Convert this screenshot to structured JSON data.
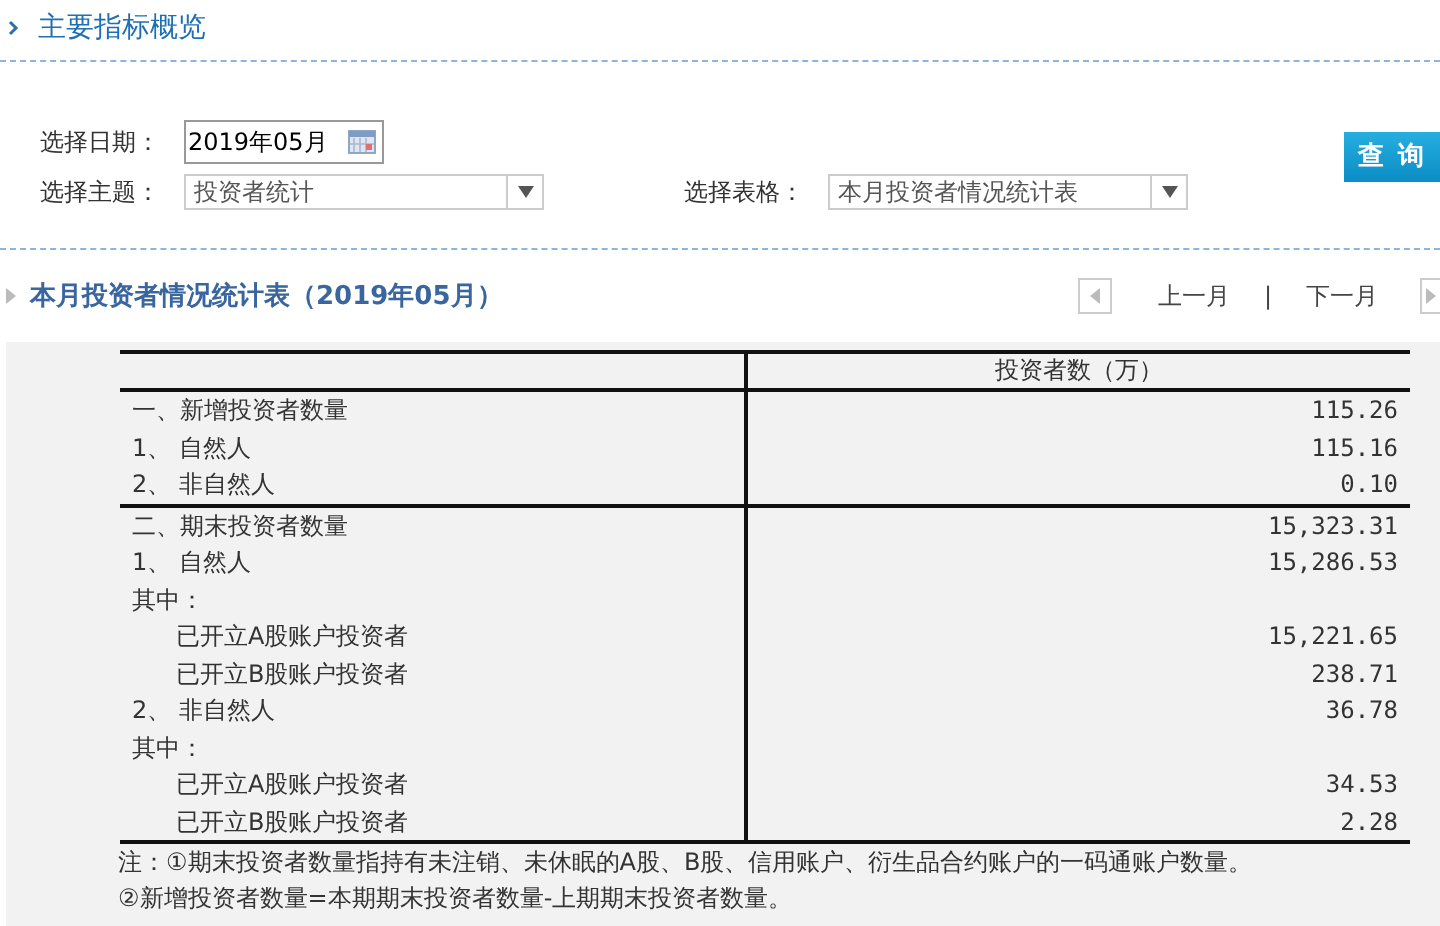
{
  "header": {
    "title": "主要指标概览"
  },
  "form": {
    "date_label": "选择日期：",
    "date_value": "2019年05月",
    "topic_label": "选择主题：",
    "topic_value": "投资者统计",
    "table_label": "选择表格：",
    "table_value": "本月投资者情况统计表",
    "query_button": "查 询"
  },
  "section": {
    "title": "本月投资者情况统计表（2019年05月）",
    "prev": "上一月",
    "separator": "|",
    "next": "下一月"
  },
  "table": {
    "columns": [
      "投资者数（万）"
    ],
    "sections": [
      {
        "rows": [
          {
            "kind": "main",
            "label": "一、新增投资者数量",
            "value": "115.26"
          },
          {
            "kind": "main",
            "label": "1、  自然人",
            "value": "115.16"
          },
          {
            "kind": "main",
            "label": "2、  非自然人",
            "value": "0.10"
          }
        ]
      },
      {
        "rows": [
          {
            "kind": "main",
            "label": "二、期末投资者数量",
            "value": "15,323.31"
          },
          {
            "kind": "main",
            "label": "1、  自然人",
            "value": "15,286.53"
          },
          {
            "kind": "main",
            "label": "其中：",
            "value": ""
          },
          {
            "kind": "sub",
            "label": "已开立A股账户投资者",
            "value": "15,221.65"
          },
          {
            "kind": "sub",
            "label": "已开立B股账户投资者",
            "value": "238.71"
          },
          {
            "kind": "main",
            "label": "2、  非自然人",
            "value": "36.78"
          },
          {
            "kind": "main",
            "label": "其中：",
            "value": ""
          },
          {
            "kind": "sub",
            "label": "已开立A股账户投资者",
            "value": "34.53"
          },
          {
            "kind": "sub",
            "label": "已开立B股账户投资者",
            "value": "2.28"
          }
        ]
      }
    ],
    "notes": [
      "注：①期末投资者数量指持有未注销、未休眠的A股、B股、信用账户、衍生品合约账户的一码通账户数量。",
      "②新增投资者数量=本期期末投资者数量-上期期末投资者数量。"
    ]
  }
}
